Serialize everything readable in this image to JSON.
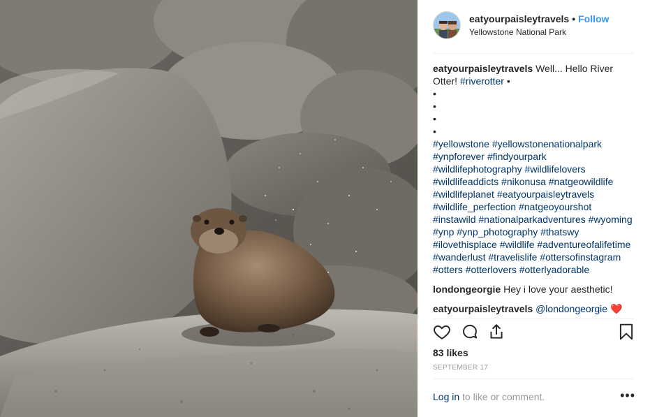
{
  "post": {
    "username": "eatyourpaisleytravels",
    "separator": "•",
    "follow_label": "Follow",
    "location": "Yellowstone National Park"
  },
  "caption": {
    "username": "eatyourpaisleytravels",
    "text_start": " Well... Hello River Otter! ",
    "inline_tag": "#riverotter",
    "text_end": " •",
    "bullets": [
      "•",
      "•",
      "•",
      "•"
    ],
    "hashtags": "#yellowstone #yellowstonenationalpark #ynpforever #findyourpark #wildlifephotography #wildlifelovers #wildlifeaddicts #nikonusa #natgeowildlife #wildlifeplanet #eatyourpaisleytravels #wildlife_perfection #natgeoyourshot #instawild #nationalparkadventures #wyoming #ynp #ynp_photography #thatswy #ilovethisplace #wildlife #adventureofalifetime #wanderlust #travelislife #ottersofinstagram #otters #otterlovers #otterlyadorable"
  },
  "comments": [
    {
      "username": "londongeorgie",
      "text": " Hey i love your aesthetic!"
    },
    {
      "username": "eatyourpaisleytravels",
      "text": " @londongeorgie ❤️"
    }
  ],
  "icons": {
    "like": "heart-icon",
    "comment": "comment-icon",
    "share": "share-icon",
    "save": "bookmark-icon",
    "more": "more-options-icon"
  },
  "likes": "83 likes",
  "date": "SEPTEMBER 17",
  "footer": {
    "login_label": "Log in",
    "rest": " to like or comment.",
    "more_label": "•••"
  },
  "colors": {
    "follow": "#3897f0",
    "hashtag": "#003569",
    "muted": "#999999",
    "text": "#262626"
  }
}
